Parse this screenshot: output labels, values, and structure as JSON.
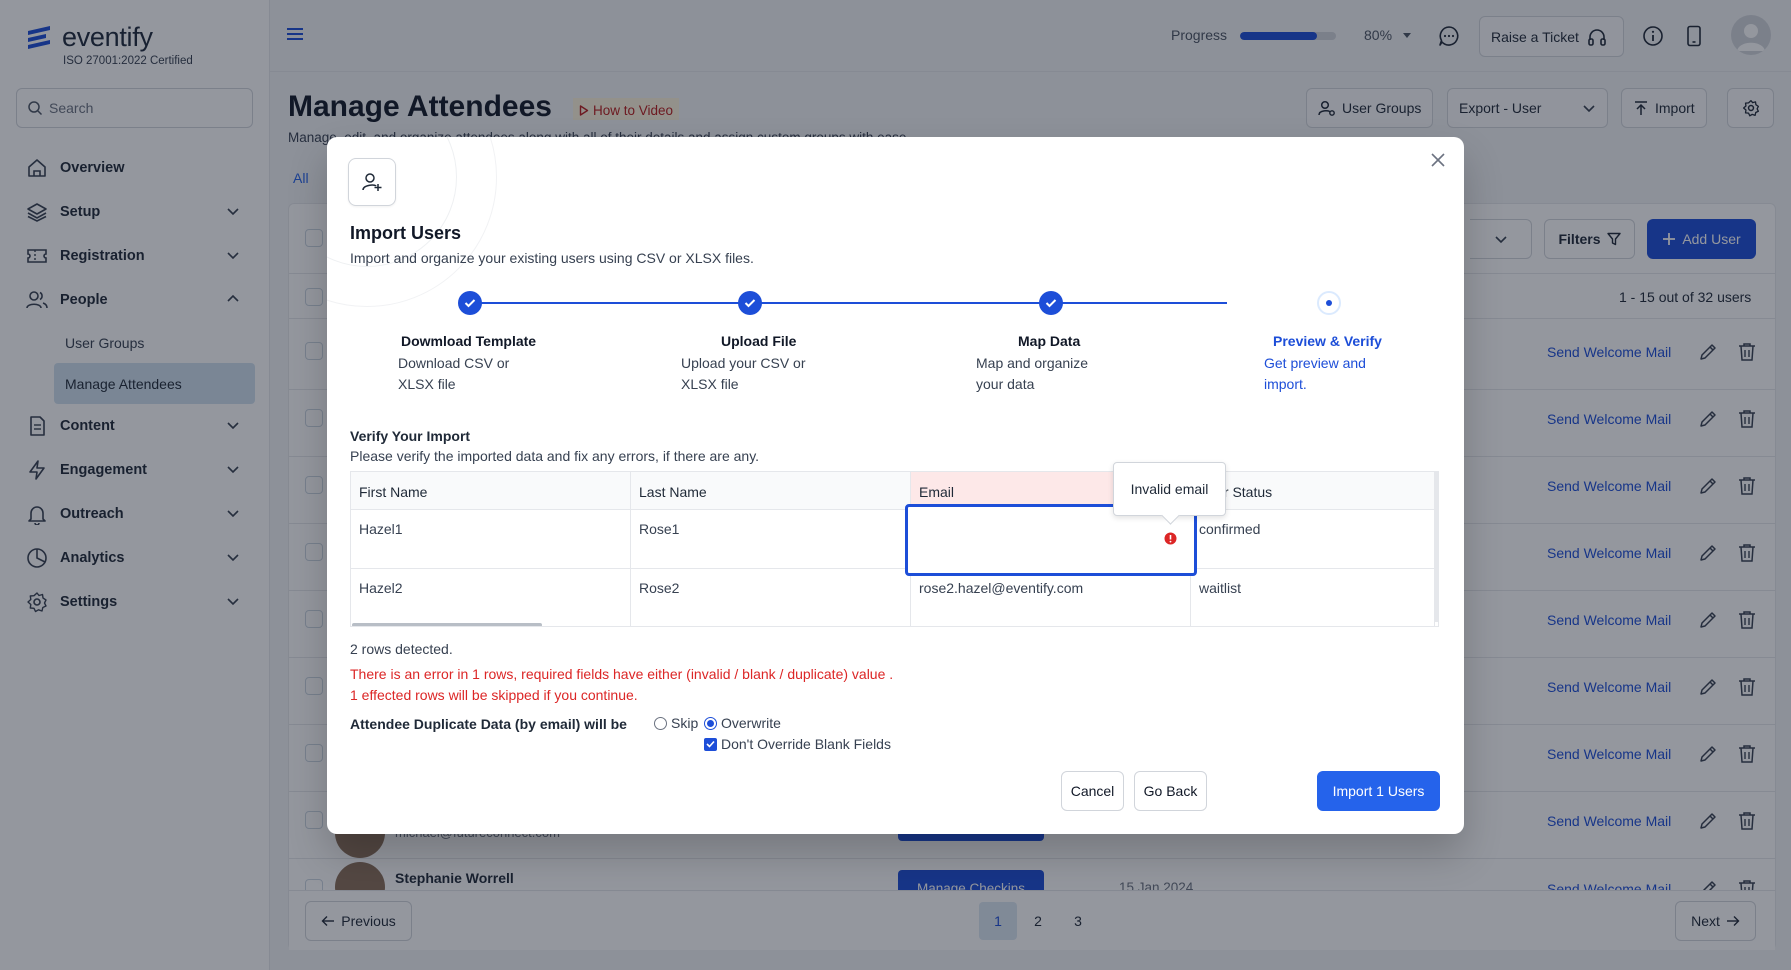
{
  "brand": {
    "name": "eventify",
    "certification": "ISO 27001:2022 Certified"
  },
  "sidebar": {
    "search_placeholder": "Search",
    "items": [
      {
        "label": "Overview",
        "icon": "home-icon"
      },
      {
        "label": "Setup",
        "icon": "layers-icon"
      },
      {
        "label": "Registration",
        "icon": "ticket-icon"
      },
      {
        "label": "People",
        "icon": "users-icon"
      },
      {
        "label": "User Groups"
      },
      {
        "label": "Manage Attendees"
      },
      {
        "label": "Content",
        "icon": "file-icon"
      },
      {
        "label": "Engagement",
        "icon": "bolt-icon"
      },
      {
        "label": "Outreach",
        "icon": "bell-icon"
      },
      {
        "label": "Analytics",
        "icon": "pie-icon"
      },
      {
        "label": "Settings",
        "icon": "gear-icon"
      }
    ]
  },
  "header": {
    "progress_label": "Progress",
    "progress_value": "80%",
    "progress_fraction": 0.8,
    "ticket_label": "Raise a Ticket"
  },
  "page": {
    "title": "Manage Attendees",
    "howto_label": "How to Video",
    "subtitle": "Manage, edit, and organize attendees along with all of their details and assign custom groups with ease.",
    "tab_all": "All",
    "buttons": {
      "user_groups": "User Groups",
      "export": "Export - User",
      "import": "Import",
      "filters": "Filters",
      "add_user": "Add User"
    },
    "count_text": "1 - 15 out of 32 users",
    "welcome_label": "Send Welcome Mail",
    "bg_email": "michael@futureconnect.com",
    "bg_name": "Stephanie Worrell",
    "checkin_label": "Manage Checkins",
    "bg_date": "15 Jan 2024",
    "pagination": {
      "previous": "Previous",
      "next": "Next",
      "pages": [
        "1",
        "2",
        "3"
      ]
    }
  },
  "modal": {
    "title": "Import Users",
    "subtitle": "Import and organize your existing users using CSV or XLSX files.",
    "steps": [
      {
        "title": "Dowmload Template",
        "desc": "Download CSV or XLSX file"
      },
      {
        "title": "Upload File",
        "desc": "Upload your CSV or XLSX file"
      },
      {
        "title": "Map Data",
        "desc": "Map and organize your data"
      },
      {
        "title": "Preview & Verify",
        "desc": "Get preview and import."
      }
    ],
    "verify_title": "Verify Your Import",
    "verify_sub": "Please verify the imported data and fix any errors, if there are any.",
    "table": {
      "headers": [
        "First Name",
        "Last Name",
        "Email",
        "User Status"
      ],
      "rows": [
        [
          "Hazel1",
          "Rose1",
          "",
          "confirmed"
        ],
        [
          "Hazel2",
          "Rose2",
          "rose2.hazel@eventify.com",
          "waitlist"
        ]
      ],
      "error_tooltip": "Invalid email"
    },
    "rows_detected": "2 rows detected.",
    "error_line1": "There is an error in 1 rows, required fields have either (invalid / blank / duplicate) value .",
    "error_line2": "1 effected rows will be skipped if you continue.",
    "duplicate_label": "Attendee Duplicate Data (by email) will be",
    "option_skip": "Skip",
    "option_overwrite": "Overwrite",
    "option_blank": "Don't Override Blank Fields",
    "btn_cancel": "Cancel",
    "btn_back": "Go Back",
    "btn_import": "Import 1 Users"
  }
}
